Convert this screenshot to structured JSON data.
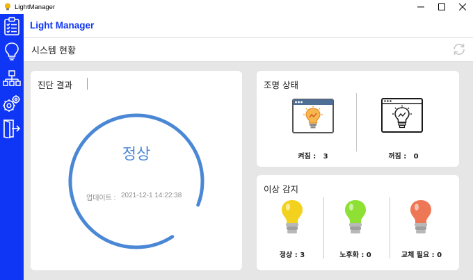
{
  "window": {
    "title": "LightManager"
  },
  "header": {
    "app_name": "Light Manager"
  },
  "page": {
    "title": "시스템 현황"
  },
  "sidebar": {
    "items": [
      {
        "icon": "clipboard-checklist-icon"
      },
      {
        "icon": "lightbulb-icon"
      },
      {
        "icon": "network-icon"
      },
      {
        "icon": "gears-icon"
      },
      {
        "icon": "exit-door-icon"
      }
    ]
  },
  "diagnosis": {
    "title": "진단 결과",
    "status": "정상",
    "update_label": "업데이트 :",
    "update_value": "2021-12-1   14:22:38",
    "gauge_fraction": 0.9,
    "gauge_color": "#4a88d6"
  },
  "lighting": {
    "title": "조명 상태",
    "on_label": "켜짐 :   3",
    "off_label": "꺼짐 :   0"
  },
  "anomaly": {
    "title": "이상 감지",
    "normal_label": "정상 : 3",
    "aging_label": "노후화 : 0",
    "replace_label": "교체 필요 : 0",
    "colors": {
      "normal": "#f2d21f",
      "aging": "#8ee035",
      "replace": "#ee7756"
    }
  },
  "colors": {
    "sidebar": "#1036f5",
    "accent": "#1036f5",
    "background": "#e6e6e6"
  }
}
